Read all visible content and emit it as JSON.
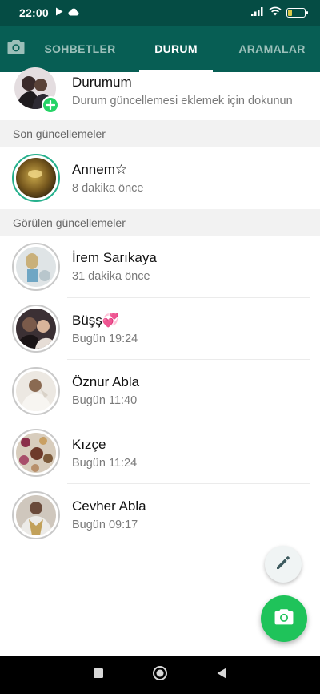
{
  "status_bar": {
    "time": "22:00",
    "battery": "27",
    "battery_level_percent": 27
  },
  "tabs": [
    {
      "label": "SOHBETLER",
      "active": false
    },
    {
      "label": "DURUM",
      "active": true
    },
    {
      "label": "ARAMALAR",
      "active": false
    }
  ],
  "my_status": {
    "name": "Durumum",
    "subtitle": "Durum güncellemesi eklemek için dokunun"
  },
  "recent_header": "Son güncellemeler",
  "recent": [
    {
      "name": "Annem☆",
      "time": "8 dakika önce"
    }
  ],
  "viewed_header": "Görülen güncellemeler",
  "viewed": [
    {
      "name": "İrem Sarıkaya",
      "time": "31 dakika önce"
    },
    {
      "name": "Büşş💞",
      "time": "Bugün 19:24"
    },
    {
      "name": "Öznur Abla",
      "time": "Bugün 11:40"
    },
    {
      "name": "Kızçe",
      "time": "Bugün 11:24"
    },
    {
      "name": "Cevher Abla",
      "time": "Bugün 09:17"
    }
  ],
  "icons": {
    "camera_tab": "camera-icon",
    "fab_small": "pencil-icon",
    "fab_main": "camera-icon",
    "add_badge": "plus-icon",
    "nav": [
      "square-icon",
      "circle-icon",
      "triangle-back-icon"
    ]
  },
  "colors": {
    "header": "#075e54",
    "statusbar": "#054c44",
    "accent": "#25d366",
    "ring_unseen": "#25b08c",
    "ring_seen": "#c9c9c9"
  }
}
